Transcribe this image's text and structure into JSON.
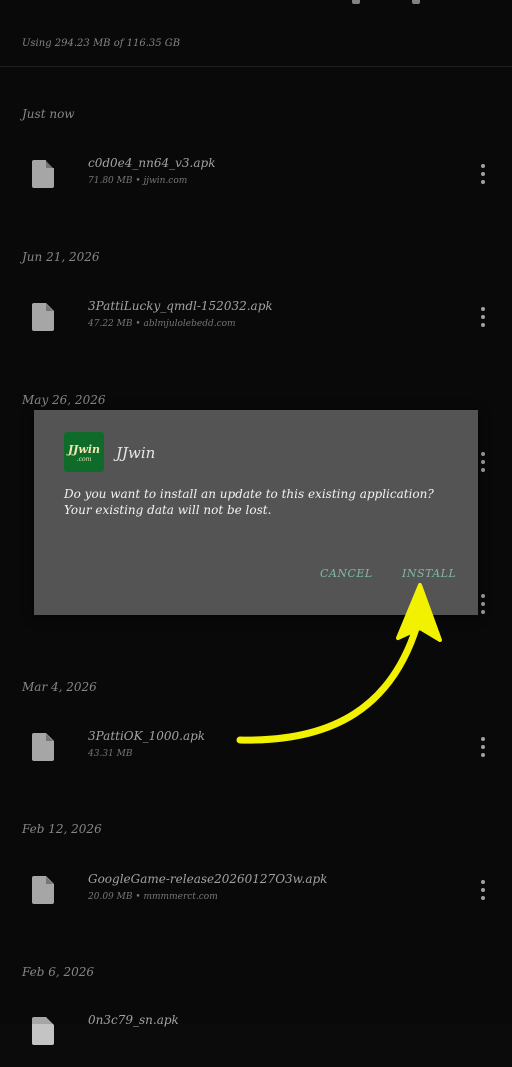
{
  "header": {
    "storage_text": "Using 294.23 MB of 116.35 GB"
  },
  "sections": [
    {
      "date": "Just now",
      "files": [
        {
          "name": "c0d0e4_nn64_v3.apk",
          "meta": "71.80 MB • jjwin.com"
        }
      ]
    },
    {
      "date": "Jun 21, 2026",
      "files": [
        {
          "name": "3PattiLucky_qmdl-152032.apk",
          "meta": "47.22 MB • ablmjulolebedd.com"
        }
      ]
    },
    {
      "date": "May 26, 2026",
      "files": []
    },
    {
      "date": "Mar 4, 2026",
      "files": [
        {
          "name": "3PattiOK_1000.apk",
          "meta": "43.31 MB"
        }
      ]
    },
    {
      "date": "Feb 12, 2026",
      "files": [
        {
          "name": "GoogleGame-release20260127O3w.apk",
          "meta": "20.09 MB • mmmmerct.com"
        }
      ]
    },
    {
      "date": "Feb 6, 2026",
      "files": [
        {
          "name": "0n3c79_sn.apk",
          "meta": ""
        }
      ]
    }
  ],
  "dialog": {
    "app_icon_text": "JJwin",
    "app_icon_subtext": ".com",
    "app_name": "JJwin",
    "message_line1": "Do you want to install an update to this existing application?",
    "message_line2": "Your existing data will not be lost.",
    "cancel_label": "CANCEL",
    "install_label": "INSTALL"
  },
  "colors": {
    "background": "#0b0b0b",
    "dialog": "#545454",
    "button_text": "#7fb8a4",
    "arrow": "#f2f200"
  }
}
